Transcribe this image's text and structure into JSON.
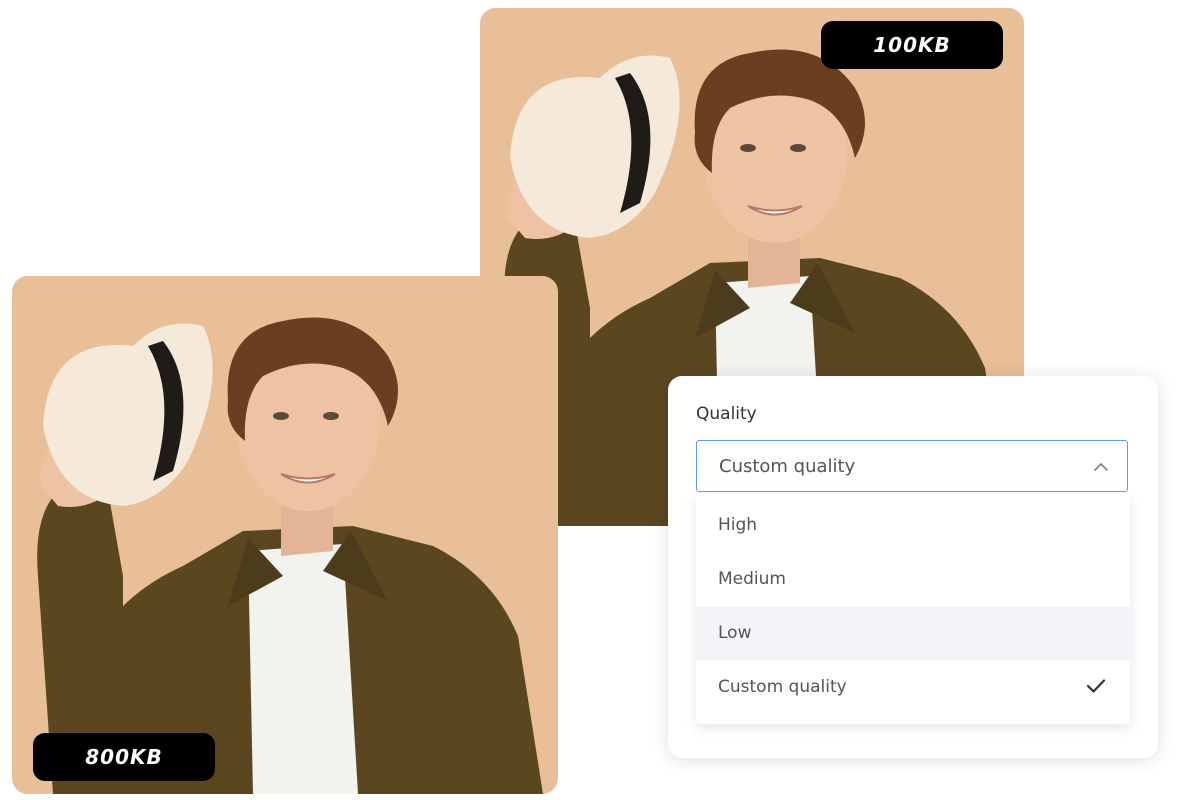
{
  "images": {
    "compressed_size": "100KB",
    "original_size": "800KB"
  },
  "quality": {
    "label": "Quality",
    "selected": "Custom quality",
    "options": [
      {
        "label": "High",
        "checked": false,
        "highlighted": false
      },
      {
        "label": "Medium",
        "checked": false,
        "highlighted": false
      },
      {
        "label": "Low",
        "checked": false,
        "highlighted": true
      },
      {
        "label": "Custom quality",
        "checked": true,
        "highlighted": false
      }
    ]
  },
  "colors": {
    "photo_background": "#e8bf96",
    "jacket": "#5a4720",
    "badge": "#000000",
    "focus_border": "#5b9be8"
  },
  "icons": [
    "chevron-up-icon",
    "checkmark-icon"
  ]
}
